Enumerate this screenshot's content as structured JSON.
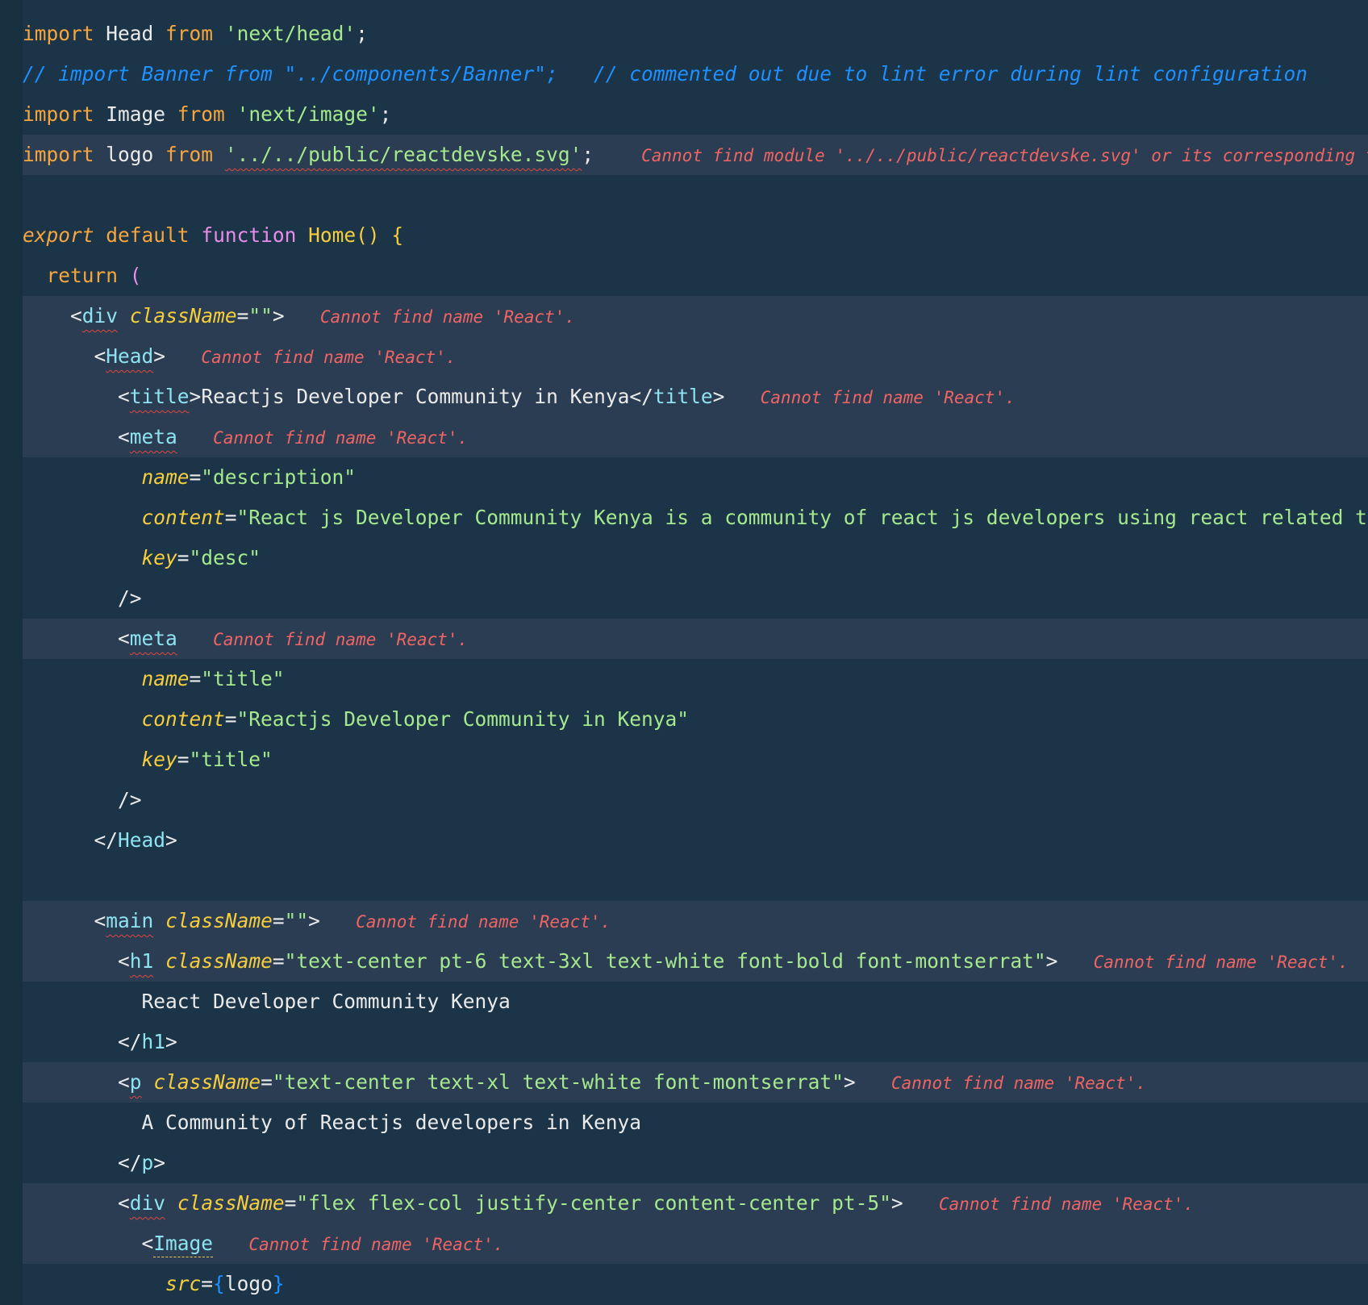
{
  "lines": {
    "l1": {
      "kw": "import",
      "name": " Head ",
      "from": "from",
      "str": "'next/head'",
      "end": ";"
    },
    "l2": {
      "comment": "// import Banner from \"../components/Banner\";   // commented out due to lint error during lint configuration"
    },
    "l3": {
      "kw": "import",
      "name": " Image ",
      "from": "from",
      "str": "'next/image'",
      "end": ";"
    },
    "l4": {
      "kw": "import",
      "name": " logo ",
      "from": "from",
      "str": "'../../public/reactdevske.svg'",
      "end": ";",
      "diag": "Cannot find module '../../public/reactdevske.svg' or its corresponding type declarations."
    },
    "l6": {
      "export": "export",
      "default": "default",
      "function": "function",
      "name": "Home",
      "paren": "()",
      "brace": "{"
    },
    "l7": {
      "ret": "return",
      "paren": "("
    },
    "l8": {
      "lt": "<",
      "tag": "div",
      "attr": "className",
      "eq": "=",
      "str": "\"\"",
      "gt": ">",
      "diag": "Cannot find name 'React'."
    },
    "l9": {
      "lt": "<",
      "tag": "Head",
      "gt": ">",
      "diag": "Cannot find name 'React'."
    },
    "l10": {
      "lt": "<",
      "tag": "title",
      "gt": ">",
      "text": "Reactjs Developer Community in Kenya",
      "clt": "</",
      "ctag": "title",
      "cgt": ">",
      "diag": "Cannot find name 'React'."
    },
    "l11": {
      "lt": "<",
      "tag": "meta",
      "diag": "Cannot find name 'React'."
    },
    "l12": {
      "attr": "name",
      "eq": "=",
      "str": "\"description\""
    },
    "l13": {
      "attr": "content",
      "eq": "=",
      "str": "\"React js Developer Community Kenya is a community of react js developers using react related technologies\""
    },
    "l14": {
      "attr": "key",
      "eq": "=",
      "str": "\"desc\""
    },
    "l15": {
      "close": "/>"
    },
    "l16": {
      "lt": "<",
      "tag": "meta",
      "diag": "Cannot find name 'React'."
    },
    "l17": {
      "attr": "name",
      "eq": "=",
      "str": "\"title\""
    },
    "l18": {
      "attr": "content",
      "eq": "=",
      "str": "\"Reactjs Developer Community in Kenya\""
    },
    "l19": {
      "attr": "key",
      "eq": "=",
      "str": "\"title\""
    },
    "l20": {
      "close": "/>"
    },
    "l21": {
      "lt": "</",
      "tag": "Head",
      "gt": ">"
    },
    "l23": {
      "lt": "<",
      "tag": "main",
      "attr": "className",
      "eq": "=",
      "str": "\"\"",
      "gt": ">",
      "diag": "Cannot find name 'React'."
    },
    "l24": {
      "lt": "<",
      "tag": "h1",
      "attr": "className",
      "eq": "=",
      "str": "\"text-center pt-6 text-3xl text-white font-bold font-montserrat\"",
      "gt": ">",
      "diag": "Cannot find name 'React'."
    },
    "l25": {
      "text": "React Developer Community Kenya"
    },
    "l26": {
      "lt": "</",
      "tag": "h1",
      "gt": ">"
    },
    "l27": {
      "lt": "<",
      "tag": "p",
      "attr": "className",
      "eq": "=",
      "str": "\"text-center text-xl text-white font-montserrat\"",
      "gt": ">",
      "diag": "Cannot find name 'React'."
    },
    "l28": {
      "text": "A Community of Reactjs developers in Kenya"
    },
    "l29": {
      "lt": "</",
      "tag": "p",
      "gt": ">"
    },
    "l30": {
      "lt": "<",
      "tag": "div",
      "attr": "className",
      "eq": "=",
      "str": "\"flex flex-col justify-center content-center pt-5\"",
      "gt": ">",
      "diag": "Cannot find name 'React'."
    },
    "l31": {
      "lt": "<",
      "tag": "Image",
      "diag": "Cannot find name 'React'."
    },
    "l32": {
      "attr": "src",
      "eq": "=",
      "ob": "{",
      "val": "logo",
      "cb": "}"
    }
  }
}
